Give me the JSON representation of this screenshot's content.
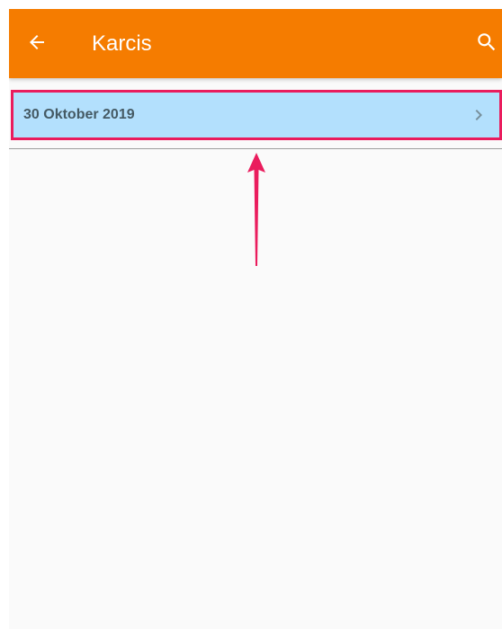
{
  "app_bar": {
    "title": "Karcis",
    "back_icon": "arrow-back-icon",
    "search_icon": "search-icon",
    "background_color": "#f57c00"
  },
  "list": {
    "items": [
      {
        "label": "30 Oktober 2019",
        "trailing_icon": "chevron-right-icon",
        "highlight_color": "#b3e0fd"
      }
    ]
  },
  "annotation": {
    "type": "arrow-pointing-up",
    "color": "#ea1c5d"
  }
}
